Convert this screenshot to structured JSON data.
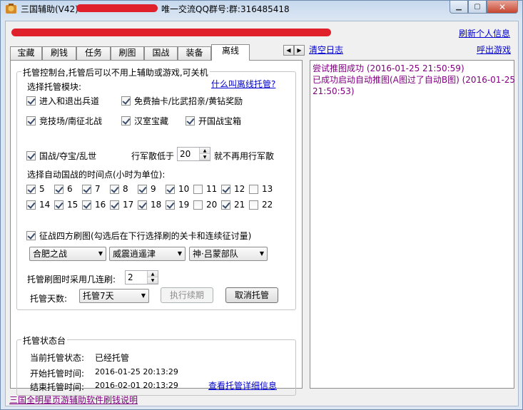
{
  "window": {
    "title": "三国辅助(V42)",
    "qq_text": "唯一交流QQ群号:群:316485418",
    "min_label": "▁",
    "max_label": "▢",
    "close_label": "✕"
  },
  "header": {
    "refresh_link": "刷新个人信息",
    "clear_log_link": "清空日志",
    "call_game_link": "呼出游戏"
  },
  "tabs": [
    {
      "label": "宝藏"
    },
    {
      "label": "刷钱"
    },
    {
      "label": "任务"
    },
    {
      "label": "刷图"
    },
    {
      "label": "国战"
    },
    {
      "label": "装备"
    },
    {
      "label": "离线"
    }
  ],
  "tab_arrows": {
    "left": "◀",
    "right": "▶"
  },
  "control": {
    "group_label": "托管控制台,托管后可以不用上辅助或游戏,可关机",
    "what_is_link": "什么叫离线托管?",
    "modules_label": "选择托管模块:",
    "modules": [
      {
        "label": "进入和退出兵道",
        "checked": true
      },
      {
        "label": "免费抽卡/比武招亲/黄钻奖励",
        "checked": true
      },
      {
        "label": "竞技场/南征北战",
        "checked": true
      },
      {
        "label": "汉室宝藏",
        "checked": true
      },
      {
        "label": "开国战宝箱",
        "checked": true
      },
      {
        "label": "国战/夺宝/乱世",
        "checked": true
      }
    ],
    "march_low_label": "行军散低于",
    "march_low_value": "20",
    "march_low_suffix": "就不再用行军散",
    "times_label": "选择自动国战的时间点(小时为单位):",
    "hours": [
      {
        "label": "5",
        "checked": true
      },
      {
        "label": "6",
        "checked": true
      },
      {
        "label": "7",
        "checked": true
      },
      {
        "label": "8",
        "checked": true
      },
      {
        "label": "9",
        "checked": true
      },
      {
        "label": "10",
        "checked": true
      },
      {
        "label": "11",
        "checked": false
      },
      {
        "label": "12",
        "checked": true
      },
      {
        "label": "13",
        "checked": false
      },
      {
        "label": "14",
        "checked": true
      },
      {
        "label": "15",
        "checked": true
      },
      {
        "label": "16",
        "checked": true
      },
      {
        "label": "17",
        "checked": true
      },
      {
        "label": "18",
        "checked": true
      },
      {
        "label": "19",
        "checked": true
      },
      {
        "label": "20",
        "checked": false
      },
      {
        "label": "21",
        "checked": true
      },
      {
        "label": "22",
        "checked": false
      }
    ],
    "expedition_label": "征战四方刷图(勾选后在下行选择刷的关卡和连续征讨量)",
    "expedition_checked": true,
    "selects": [
      "合肥之战",
      "威震逍遥津",
      "神·吕蒙部队"
    ],
    "repeat_label": "托管刷图时采用几连刷:",
    "repeat_value": "2",
    "days_label": "托管天数:",
    "days_value": "托管7天",
    "execute_button": "执行续期",
    "cancel_button": "取消托管"
  },
  "status": {
    "group_label": "托管状态台",
    "state_label": "当前托管状态:",
    "state_value": "已经托管",
    "start_label": "开始托管时间:",
    "start_value": "2016-01-25 20:13:29",
    "end_label": "结束托管时间:",
    "end_value": "2016-02-01 20:13:29",
    "details_link": "查看托管详细信息"
  },
  "log": [
    {
      "text": "尝试推图成功 (2016-01-25 21:50:59)"
    },
    {
      "text": "已成功启动自动推图(A图过了自动B图) (2016-01-25"
    },
    {
      "text": "21:50:53)"
    }
  ],
  "footer": {
    "help_link": "三国全明星页游辅助软件刷钱说明"
  }
}
